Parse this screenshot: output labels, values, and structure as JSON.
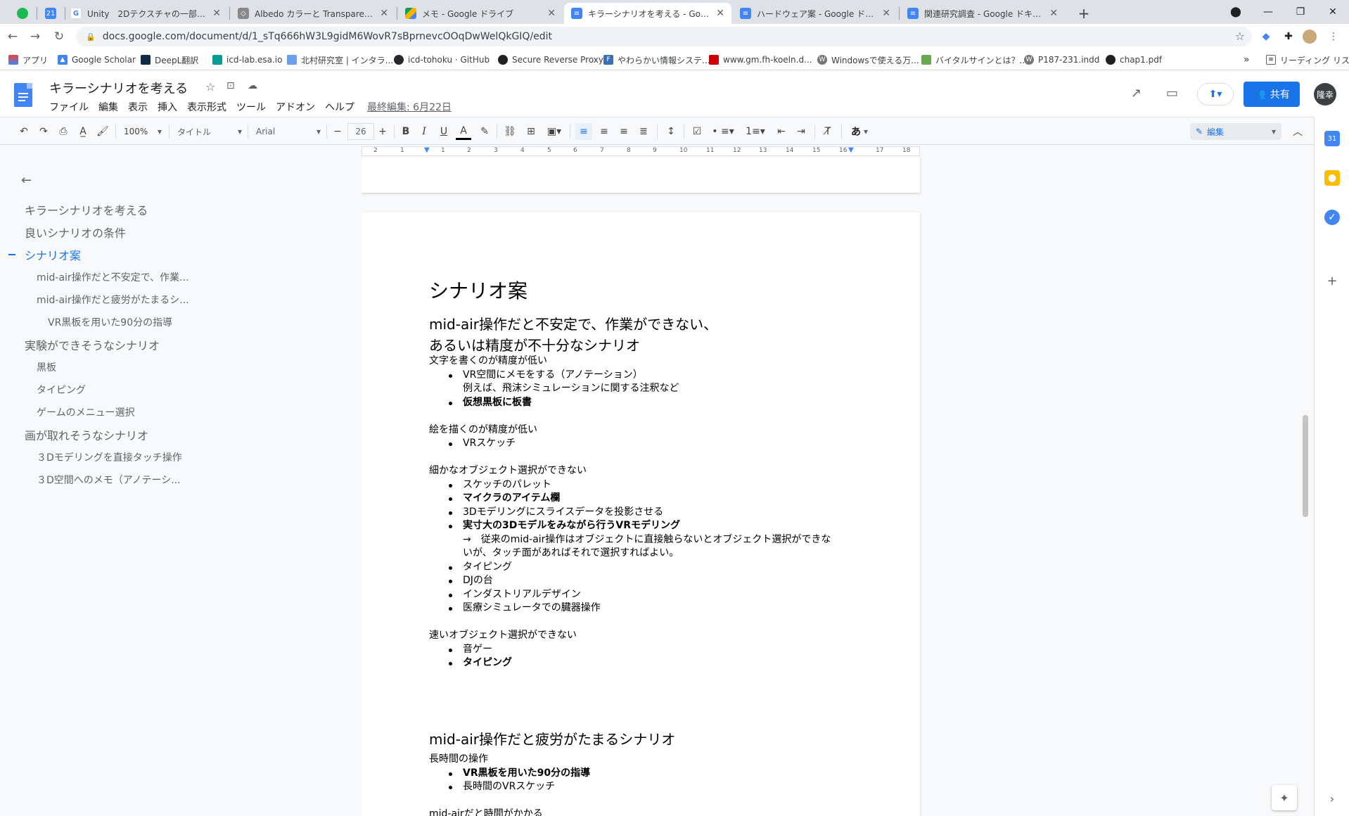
{
  "tabs": [
    {
      "label": "",
      "icon": "spotify-icon"
    },
    {
      "label": "",
      "icon": "calendar-icon"
    },
    {
      "label": "Unity　2Dテクスチャの一部を　透明",
      "icon": "google-icon"
    },
    {
      "label": "Albedo カラーと Transparency（透明",
      "icon": "unity-icon"
    },
    {
      "label": "メモ - Google ドライブ",
      "icon": "drive-icon"
    },
    {
      "label": "キラーシナリオを考える - Google ドキ",
      "icon": "docs-icon"
    },
    {
      "label": "ハードウェア案 - Google ドキュメント",
      "icon": "docs-icon"
    },
    {
      "label": "関連研究調査 - Google ドキュメント",
      "icon": "docs-icon"
    }
  ],
  "address": {
    "url": "docs.google.com/document/d/1_sTq666hW3L9gidM6WovR7sBprnevcOOqDwWelQkGIQ/edit"
  },
  "bookmarks": [
    "アプリ",
    "Google Scholar",
    "DeepL翻訳",
    "icd-lab.esa.io",
    "北村研究室 | インタラ...",
    "icd-tohoku · GitHub",
    "Secure Reverse Proxy",
    "やわらかい情報システ...",
    "www.gm.fh-koeln.d...",
    "Windowsで使える万...",
    "バイタルサインとは？...",
    "P187-231.indd",
    "chap1.pdf"
  ],
  "reading_list": "リーディング リスト",
  "doc": {
    "title": "キラーシナリオを考える",
    "menus": [
      "ファイル",
      "編集",
      "表示",
      "挿入",
      "表示形式",
      "ツール",
      "アドオン",
      "ヘルプ"
    ],
    "last_edit": "最終編集: 6月22日",
    "share": "共有",
    "avatar": "隆幸"
  },
  "toolbar": {
    "zoom": "100%",
    "style": "タイトル",
    "font": "Arial",
    "size": "26",
    "mode": "編集",
    "ime": "あ"
  },
  "ruler": [
    "2",
    "1",
    "1",
    "2",
    "3",
    "4",
    "5",
    "6",
    "7",
    "8",
    "9",
    "10",
    "11",
    "12",
    "13",
    "14",
    "15",
    "16",
    "17",
    "18"
  ],
  "outline": [
    {
      "label": "キラーシナリオを考える",
      "level": 1
    },
    {
      "label": "良いシナリオの条件",
      "level": 1
    },
    {
      "label": "シナリオ案",
      "level": 1
    },
    {
      "label": "mid-air操作だと不安定で、作業...",
      "level": 2
    },
    {
      "label": "mid-air操作だと疲労がたまるシ...",
      "level": 2
    },
    {
      "label": "VR黒板を用いた90分の指導",
      "level": 3
    },
    {
      "label": "実験ができそうなシナリオ",
      "level": 1
    },
    {
      "label": "黒板",
      "level": 2
    },
    {
      "label": "タイピング",
      "level": 2
    },
    {
      "label": "ゲームのメニュー選択",
      "level": 2
    },
    {
      "label": "画が取れそうなシナリオ",
      "level": 1
    },
    {
      "label": "３Dモデリングを直接タッチ操作",
      "level": 2
    },
    {
      "label": "３D空間へのメモ（アノテーシ...",
      "level": 2
    }
  ],
  "content": {
    "title": "シナリオ案",
    "h2a_1": "mid-air操作だと不安定で、作業ができない、",
    "h2a_2": "あるいは精度が不十分なシナリオ",
    "p1": "文字を書くのが精度が低い",
    "l1a": "VR空間にメモをする（アノテーション）",
    "l1a2": "例えば、飛沫シミュレーションに関する注釈など",
    "l1b": "仮想黒板に板書",
    "p2": "絵を描くのが精度が低い",
    "l2a": "VRスケッチ",
    "p3": "細かなオブジェクト選択ができない",
    "l3a": "スケッチのパレット",
    "l3b": "マイクラのアイテム欄",
    "l3c": "3Dモデリングにスライスデータを投影させる",
    "l3d": "実寸大の3Dモデルをみながら行うVRモデリング",
    "l3d2": "→　従来のmid-air操作はオブジェクトに直接触らないとオブジェクト選択ができな",
    "l3d3": "いが、タッチ面があればそれで選択すればよい。",
    "l3e": "タイピング",
    "l3f": "DJの台",
    "l3g": "インダストリアルデザイン",
    "l3h": "医療シミュレータでの臓器操作",
    "p4": "速いオブジェクト選択ができない",
    "l4a": "音ゲー",
    "l4b": "タイピング",
    "h2b": "mid-air操作だと疲労がたまるシナリオ",
    "p5": "長時間の操作",
    "l5a": "VR黒板を用いた90分の指導",
    "l5b": "長時間のVRスケッチ",
    "p6": "mid-airだと時間がかかる"
  },
  "colors": {
    "accent": "#1a73e8",
    "docs_blue": "#4285f4"
  }
}
